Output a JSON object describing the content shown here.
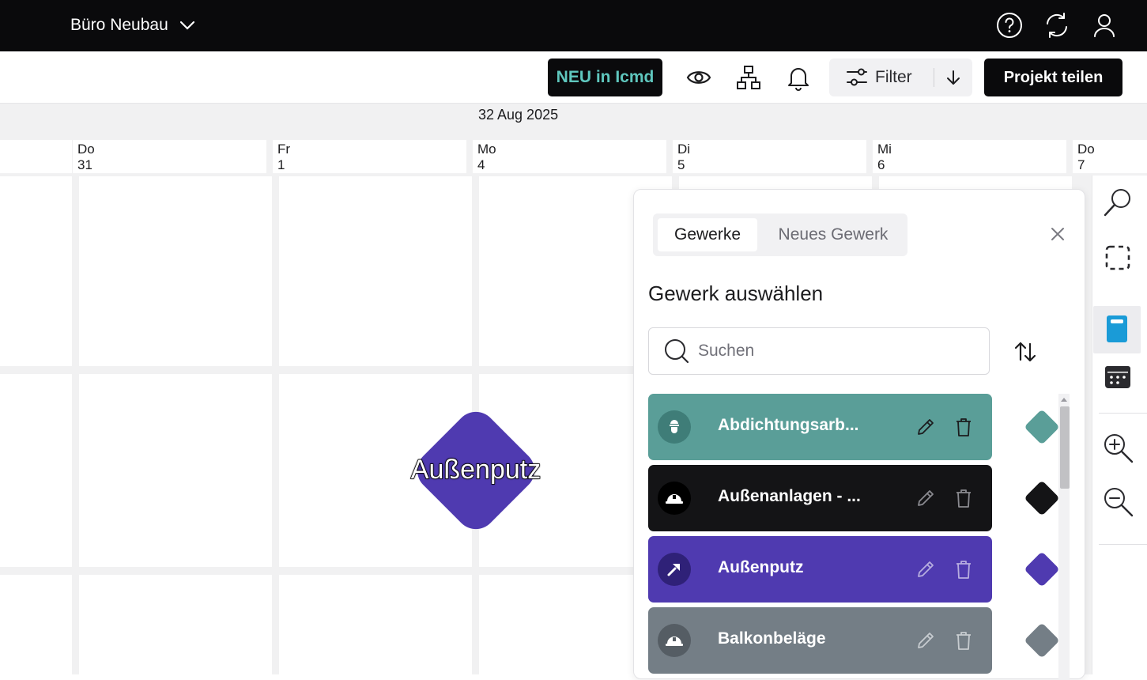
{
  "topbar": {
    "project_name": "Büro Neubau",
    "icons": [
      "chevron-down-icon",
      "help-icon",
      "sync-icon",
      "user-icon"
    ]
  },
  "toolbar": {
    "neu_label": "NEU in Icmd",
    "filter_label": "Filter",
    "share_label": "Projekt teilen",
    "icons": [
      "eye-icon",
      "hierarchy-icon",
      "bell-icon",
      "filter-icon",
      "arrow-down-icon"
    ]
  },
  "calendar": {
    "month_label": "32 Aug 2025",
    "days": [
      {
        "weekday": "Do",
        "day": "31"
      },
      {
        "weekday": "Fr",
        "day": "1"
      },
      {
        "weekday": "Mo",
        "day": "4"
      },
      {
        "weekday": "Di",
        "day": "5"
      },
      {
        "weekday": "Mi",
        "day": "6"
      },
      {
        "weekday": "Do",
        "day": "7"
      }
    ],
    "milestone": {
      "label": "Außenputz",
      "color": "#4f3ab0"
    }
  },
  "panel": {
    "tabs": [
      {
        "label": "Gewerke",
        "active": true
      },
      {
        "label": "Neues Gewerk",
        "active": false
      }
    ],
    "title": "Gewerk auswählen",
    "search_placeholder": "Suchen",
    "items": [
      {
        "name": "Abdichtungsarb...",
        "color": "#5a9e98",
        "avatar_color": "#3f7d78",
        "icon": "worker-icon"
      },
      {
        "name": "Außenanlagen - ...",
        "color": "#141416",
        "avatar_color": "#000000",
        "icon": "hardhat-icon"
      },
      {
        "name": "Außenputz",
        "color": "#4f3ab0",
        "avatar_color": "#2f2178",
        "icon": "trowel-icon"
      },
      {
        "name": "Balkonbeläge",
        "color": "#747e86",
        "avatar_color": "#555d64",
        "icon": "hardhat-icon"
      }
    ]
  },
  "rightbar": {
    "icons": [
      "search-icon",
      "selection-icon",
      "notebook-icon",
      "calendar-grid-icon",
      "zoom-in-icon",
      "zoom-out-icon"
    ],
    "accent": "#1a9bd7"
  }
}
